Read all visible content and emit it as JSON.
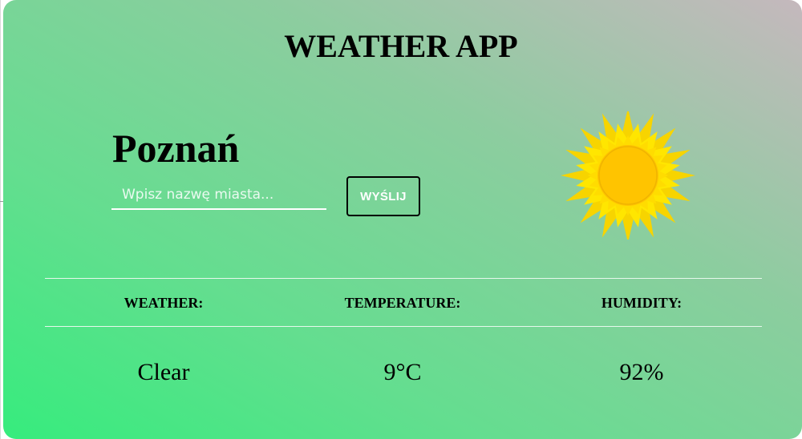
{
  "app": {
    "title": "WEATHER APP"
  },
  "location": {
    "city": "Poznań"
  },
  "search": {
    "placeholder": "Wpisz nazwę miasta...",
    "value": ""
  },
  "actions": {
    "send_label": "WYŚLIJ"
  },
  "weather_icon": {
    "name": "sun-icon",
    "ray_color": "#ffe600",
    "core_color": "#ffc400"
  },
  "table": {
    "headers": [
      "WEATHER:",
      "TEMPERATURE:",
      "HUMIDITY:"
    ],
    "values": [
      "Clear",
      "9°C",
      "92%"
    ]
  },
  "theme": {
    "gradient_start": "#36ec7d",
    "gradient_end": "#c5b8bd"
  }
}
